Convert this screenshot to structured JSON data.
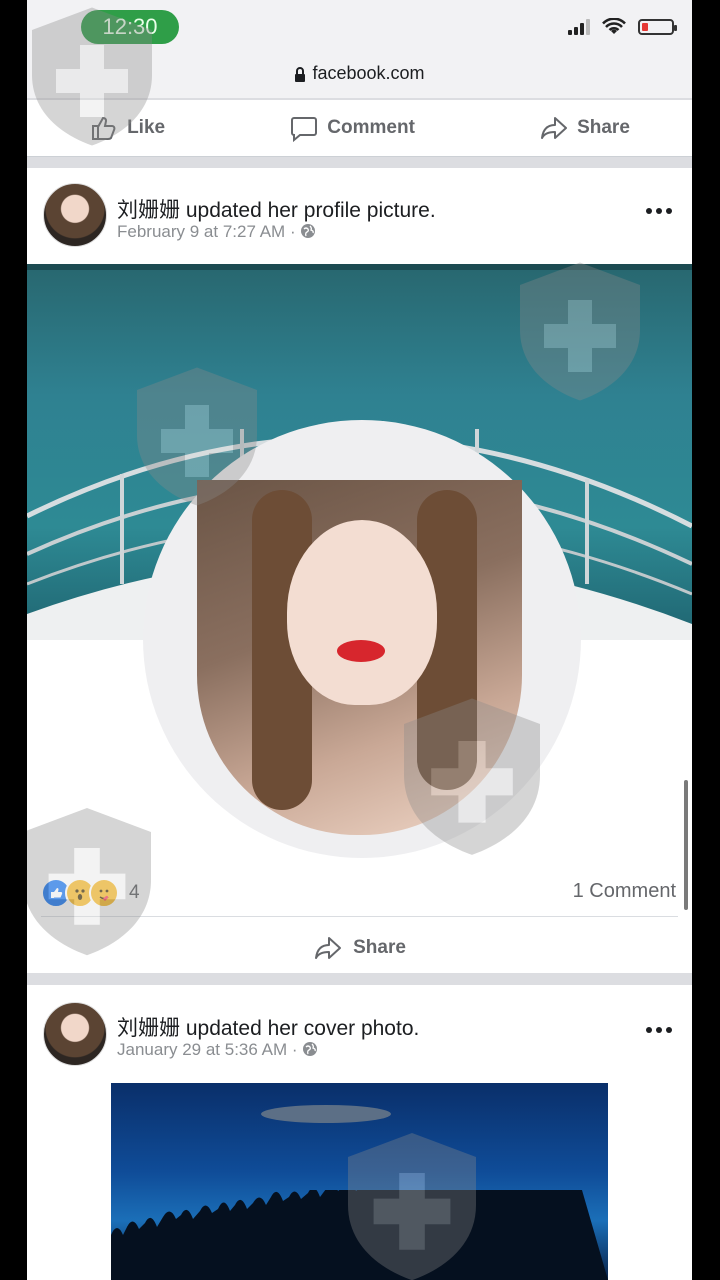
{
  "status": {
    "time": "12:30",
    "url": "facebook.com"
  },
  "action_bar": {
    "like": "Like",
    "comment": "Comment",
    "share": "Share"
  },
  "post1": {
    "author": "刘姗姗",
    "action": " updated her profile picture.",
    "date": "February 9 at 7:27 AM",
    "separator": "·",
    "reactions": [
      "like-icon",
      "wow-icon",
      "care-icon"
    ],
    "reaction_count": "4",
    "comments": "1 Comment",
    "share": "Share"
  },
  "post2": {
    "author": "刘姗姗",
    "action": " updated her cover photo.",
    "date": "January 29 at 5:36 AM",
    "separator": "·"
  },
  "colors": {
    "facebook_blue": "#1877f2",
    "time_pill": "#2f9e48",
    "battery_low": "#e53935"
  }
}
